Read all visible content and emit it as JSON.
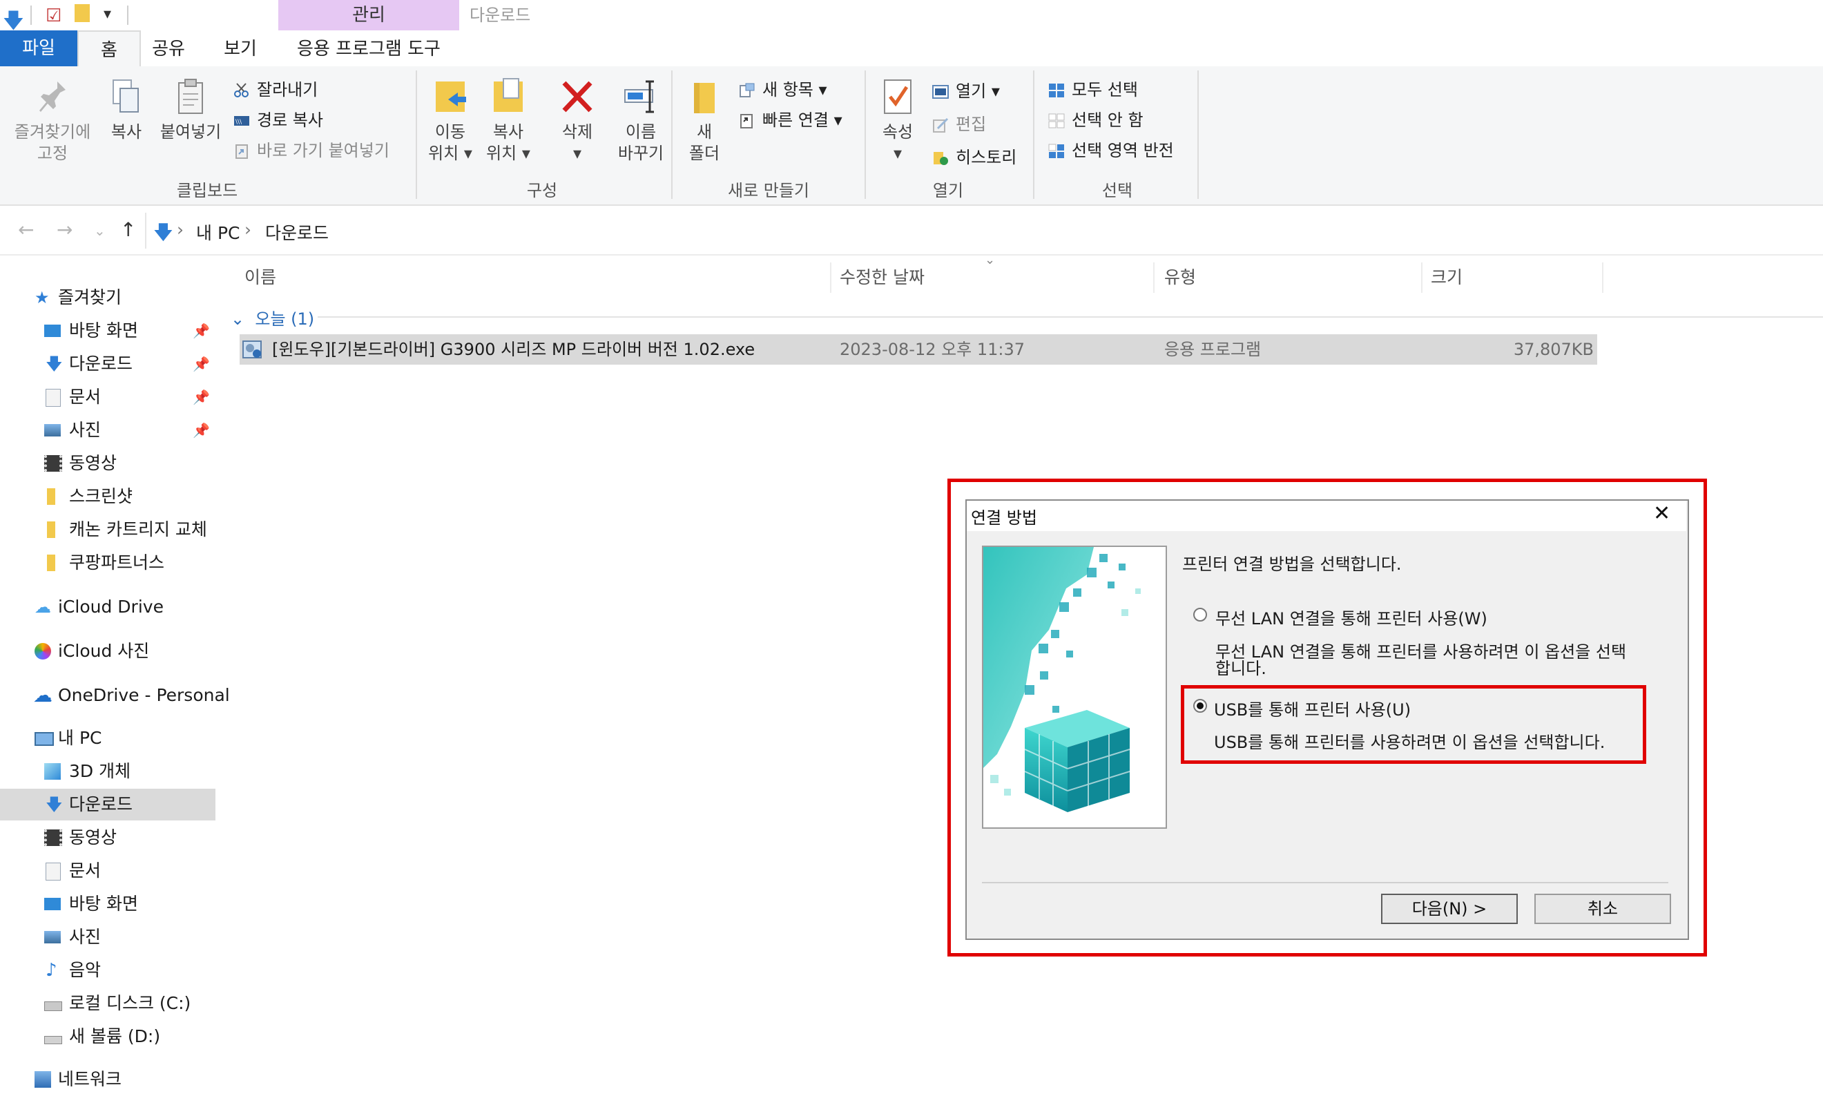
{
  "window": {
    "contextual_group": "관리",
    "contextual_title": "다운로드"
  },
  "ribbon_tabs": [
    "파일",
    "홈",
    "공유",
    "보기",
    "응용 프로그램 도구"
  ],
  "ribbon": {
    "clipboard": {
      "label": "클립보드",
      "pin_quick": "즐겨찾기에 고정",
      "pin_quick_l1": "즐겨찾기에",
      "pin_quick_l2": "고정",
      "copy": "복사",
      "paste": "붙여넣기",
      "cut": "잘라내기",
      "copy_path": "경로 복사",
      "paste_shortcut": "바로 가기 붙여넣기"
    },
    "organize": {
      "label": "구성",
      "move_to_l1": "이동",
      "move_to_l2": "위치",
      "copy_to_l1": "복사",
      "copy_to_l2": "위치",
      "delete": "삭제",
      "rename_l1": "이름",
      "rename_l2": "바꾸기"
    },
    "new": {
      "label": "새로 만들기",
      "new_folder_l1": "새",
      "new_folder_l2": "폴더",
      "new_item": "새 항목",
      "easy_access": "빠른 연결"
    },
    "open": {
      "label": "열기",
      "properties": "속성",
      "open": "열기",
      "edit": "편집",
      "history": "히스토리"
    },
    "select": {
      "label": "선택",
      "select_all": "모두 선택",
      "select_none": "선택 안 함",
      "invert": "선택 영역 반전"
    }
  },
  "address": {
    "segments": [
      "내 PC",
      "다운로드"
    ]
  },
  "sidebar": {
    "quick_access": "즐겨찾기",
    "quick_items": [
      "바탕 화면",
      "다운로드",
      "문서",
      "사진",
      "동영상",
      "스크린샷",
      "캐논 카트리지 교체",
      "쿠팡파트너스"
    ],
    "icloud_drive": "iCloud Drive",
    "icloud_photos": "iCloud 사진",
    "onedrive": "OneDrive - Personal",
    "this_pc": "내 PC",
    "pc_items": [
      "3D 개체",
      "다운로드",
      "동영상",
      "문서",
      "바탕 화면",
      "사진",
      "음악",
      "로컬 디스크 (C:)",
      "새 볼륨 (D:)"
    ],
    "network": "네트워크"
  },
  "columns": [
    "이름",
    "수정한 날짜",
    "유형",
    "크기"
  ],
  "group": {
    "label": "오늘 (1)"
  },
  "file": {
    "name": "[윈도우][기본드라이버] G3900 시리즈 MP 드라이버 버전 1.02.exe",
    "modified": "2023-08-12 오후 11:37",
    "type": "응용 프로그램",
    "size": "37,807KB"
  },
  "dialog": {
    "title": "연결 방법",
    "prompt": "프린터 연결 방법을 선택합니다.",
    "option_wlan": "무선 LAN 연결을 통해 프린터 사용(W)",
    "option_wlan_desc_l1": "무선 LAN 연결을 통해 프린터를 사용하려면 이 옵션을 선택",
    "option_wlan_desc_l2": "합니다.",
    "option_usb": "USB를 통해 프린터 사용(U)",
    "option_usb_desc": "USB를 통해 프린터를 사용하려면 이 옵션을 선택합니다.",
    "next": "다음(N) >",
    "cancel": "취소"
  },
  "colors": {
    "accent": "#1f6fc9",
    "highlight_red": "#e00000",
    "contextual_tab": "#e6c8f3"
  }
}
